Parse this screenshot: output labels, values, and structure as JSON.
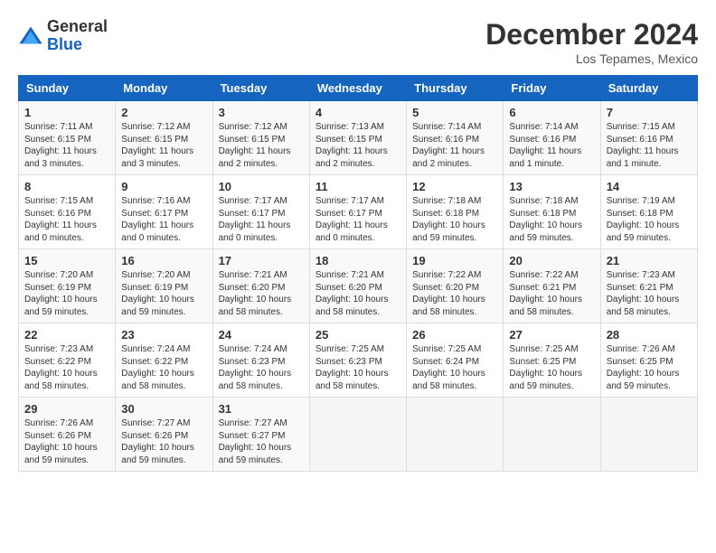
{
  "header": {
    "logo_general": "General",
    "logo_blue": "Blue",
    "month_year": "December 2024",
    "location": "Los Tepames, Mexico"
  },
  "weekdays": [
    "Sunday",
    "Monday",
    "Tuesday",
    "Wednesday",
    "Thursday",
    "Friday",
    "Saturday"
  ],
  "weeks": [
    [
      {
        "day": "1",
        "sunrise": "7:11 AM",
        "sunset": "6:15 PM",
        "daylight": "11 hours and 3 minutes."
      },
      {
        "day": "2",
        "sunrise": "7:12 AM",
        "sunset": "6:15 PM",
        "daylight": "11 hours and 3 minutes."
      },
      {
        "day": "3",
        "sunrise": "7:12 AM",
        "sunset": "6:15 PM",
        "daylight": "11 hours and 2 minutes."
      },
      {
        "day": "4",
        "sunrise": "7:13 AM",
        "sunset": "6:15 PM",
        "daylight": "11 hours and 2 minutes."
      },
      {
        "day": "5",
        "sunrise": "7:14 AM",
        "sunset": "6:16 PM",
        "daylight": "11 hours and 2 minutes."
      },
      {
        "day": "6",
        "sunrise": "7:14 AM",
        "sunset": "6:16 PM",
        "daylight": "11 hours and 1 minute."
      },
      {
        "day": "7",
        "sunrise": "7:15 AM",
        "sunset": "6:16 PM",
        "daylight": "11 hours and 1 minute."
      }
    ],
    [
      {
        "day": "8",
        "sunrise": "7:15 AM",
        "sunset": "6:16 PM",
        "daylight": "11 hours and 0 minutes."
      },
      {
        "day": "9",
        "sunrise": "7:16 AM",
        "sunset": "6:17 PM",
        "daylight": "11 hours and 0 minutes."
      },
      {
        "day": "10",
        "sunrise": "7:17 AM",
        "sunset": "6:17 PM",
        "daylight": "11 hours and 0 minutes."
      },
      {
        "day": "11",
        "sunrise": "7:17 AM",
        "sunset": "6:17 PM",
        "daylight": "11 hours and 0 minutes."
      },
      {
        "day": "12",
        "sunrise": "7:18 AM",
        "sunset": "6:18 PM",
        "daylight": "10 hours and 59 minutes."
      },
      {
        "day": "13",
        "sunrise": "7:18 AM",
        "sunset": "6:18 PM",
        "daylight": "10 hours and 59 minutes."
      },
      {
        "day": "14",
        "sunrise": "7:19 AM",
        "sunset": "6:18 PM",
        "daylight": "10 hours and 59 minutes."
      }
    ],
    [
      {
        "day": "15",
        "sunrise": "7:20 AM",
        "sunset": "6:19 PM",
        "daylight": "10 hours and 59 minutes."
      },
      {
        "day": "16",
        "sunrise": "7:20 AM",
        "sunset": "6:19 PM",
        "daylight": "10 hours and 59 minutes."
      },
      {
        "day": "17",
        "sunrise": "7:21 AM",
        "sunset": "6:20 PM",
        "daylight": "10 hours and 58 minutes."
      },
      {
        "day": "18",
        "sunrise": "7:21 AM",
        "sunset": "6:20 PM",
        "daylight": "10 hours and 58 minutes."
      },
      {
        "day": "19",
        "sunrise": "7:22 AM",
        "sunset": "6:20 PM",
        "daylight": "10 hours and 58 minutes."
      },
      {
        "day": "20",
        "sunrise": "7:22 AM",
        "sunset": "6:21 PM",
        "daylight": "10 hours and 58 minutes."
      },
      {
        "day": "21",
        "sunrise": "7:23 AM",
        "sunset": "6:21 PM",
        "daylight": "10 hours and 58 minutes."
      }
    ],
    [
      {
        "day": "22",
        "sunrise": "7:23 AM",
        "sunset": "6:22 PM",
        "daylight": "10 hours and 58 minutes."
      },
      {
        "day": "23",
        "sunrise": "7:24 AM",
        "sunset": "6:22 PM",
        "daylight": "10 hours and 58 minutes."
      },
      {
        "day": "24",
        "sunrise": "7:24 AM",
        "sunset": "6:23 PM",
        "daylight": "10 hours and 58 minutes."
      },
      {
        "day": "25",
        "sunrise": "7:25 AM",
        "sunset": "6:23 PM",
        "daylight": "10 hours and 58 minutes."
      },
      {
        "day": "26",
        "sunrise": "7:25 AM",
        "sunset": "6:24 PM",
        "daylight": "10 hours and 58 minutes."
      },
      {
        "day": "27",
        "sunrise": "7:25 AM",
        "sunset": "6:25 PM",
        "daylight": "10 hours and 59 minutes."
      },
      {
        "day": "28",
        "sunrise": "7:26 AM",
        "sunset": "6:25 PM",
        "daylight": "10 hours and 59 minutes."
      }
    ],
    [
      {
        "day": "29",
        "sunrise": "7:26 AM",
        "sunset": "6:26 PM",
        "daylight": "10 hours and 59 minutes."
      },
      {
        "day": "30",
        "sunrise": "7:27 AM",
        "sunset": "6:26 PM",
        "daylight": "10 hours and 59 minutes."
      },
      {
        "day": "31",
        "sunrise": "7:27 AM",
        "sunset": "6:27 PM",
        "daylight": "10 hours and 59 minutes."
      },
      null,
      null,
      null,
      null
    ]
  ],
  "labels": {
    "sunrise": "Sunrise:",
    "sunset": "Sunset:",
    "daylight": "Daylight:"
  }
}
